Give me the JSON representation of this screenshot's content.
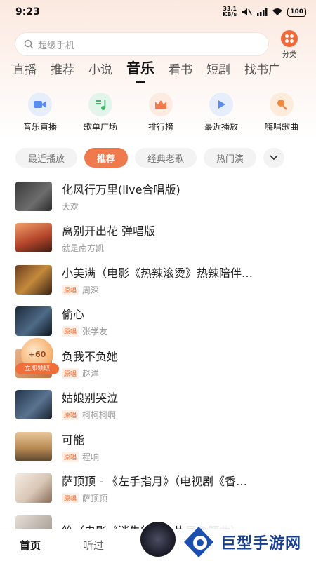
{
  "status": {
    "time": "9:23",
    "speed_value": "33.1",
    "speed_unit": "KB/s",
    "battery": "100"
  },
  "search": {
    "placeholder": "超级手机"
  },
  "category": {
    "label": "分类"
  },
  "tabs": [
    {
      "label": "直播"
    },
    {
      "label": "推荐"
    },
    {
      "label": "小说"
    },
    {
      "label": "音乐"
    },
    {
      "label": "看书"
    },
    {
      "label": "短剧"
    },
    {
      "label": "找书广"
    }
  ],
  "active_tab": "音乐",
  "quick_actions": [
    {
      "label": "音乐直播",
      "icon": "camera-icon",
      "color": "#5b8def"
    },
    {
      "label": "歌单广场",
      "icon": "music-note-icon",
      "color": "#3fb970"
    },
    {
      "label": "排行榜",
      "icon": "crown-icon",
      "color": "#ef7a4e"
    },
    {
      "label": "最近播放",
      "icon": "play-icon",
      "color": "#5b8def"
    },
    {
      "label": "嗨唱歌曲",
      "icon": "microphone-icon",
      "color": "#ef8a3e"
    }
  ],
  "chips": [
    {
      "label": "最近播放"
    },
    {
      "label": "推荐"
    },
    {
      "label": "经典老歌"
    },
    {
      "label": "热门演"
    }
  ],
  "songs": [
    {
      "title": "化风行万里(live合唱版)",
      "badge": "",
      "artist": "大欢"
    },
    {
      "title": "离别开出花 弹唱版",
      "badge": "",
      "artist": "就是南方凯"
    },
    {
      "title": "小美满（电影《热辣滚烫》热辣陪伴…",
      "badge": "原唱",
      "artist": "周深"
    },
    {
      "title": "偷心",
      "badge": "原唱",
      "artist": "张学友"
    },
    {
      "title": "负我不负她",
      "badge": "原唱",
      "artist": "赵洋"
    },
    {
      "title": "姑娘别哭泣",
      "badge": "原唱",
      "artist": "柯柯柯啊"
    },
    {
      "title": "可能",
      "badge": "原唱",
      "artist": "程响"
    },
    {
      "title": "萨顶顶 - 《左手指月》（电视剧《香…",
      "badge": "原唱",
      "artist": "萨顶顶"
    },
    {
      "title": "笼（电影《消失的她》片尾主题曲）",
      "badge": "",
      "artist": ""
    }
  ],
  "coin_reward": {
    "amount": "+60",
    "label": "立即领取"
  },
  "bottom_nav": {
    "home": "首页",
    "listened": "听过"
  },
  "watermark": {
    "text": "巨型手游网"
  },
  "colors": {
    "accent": "#ef7a4e",
    "badge_text": "#e8672e"
  }
}
